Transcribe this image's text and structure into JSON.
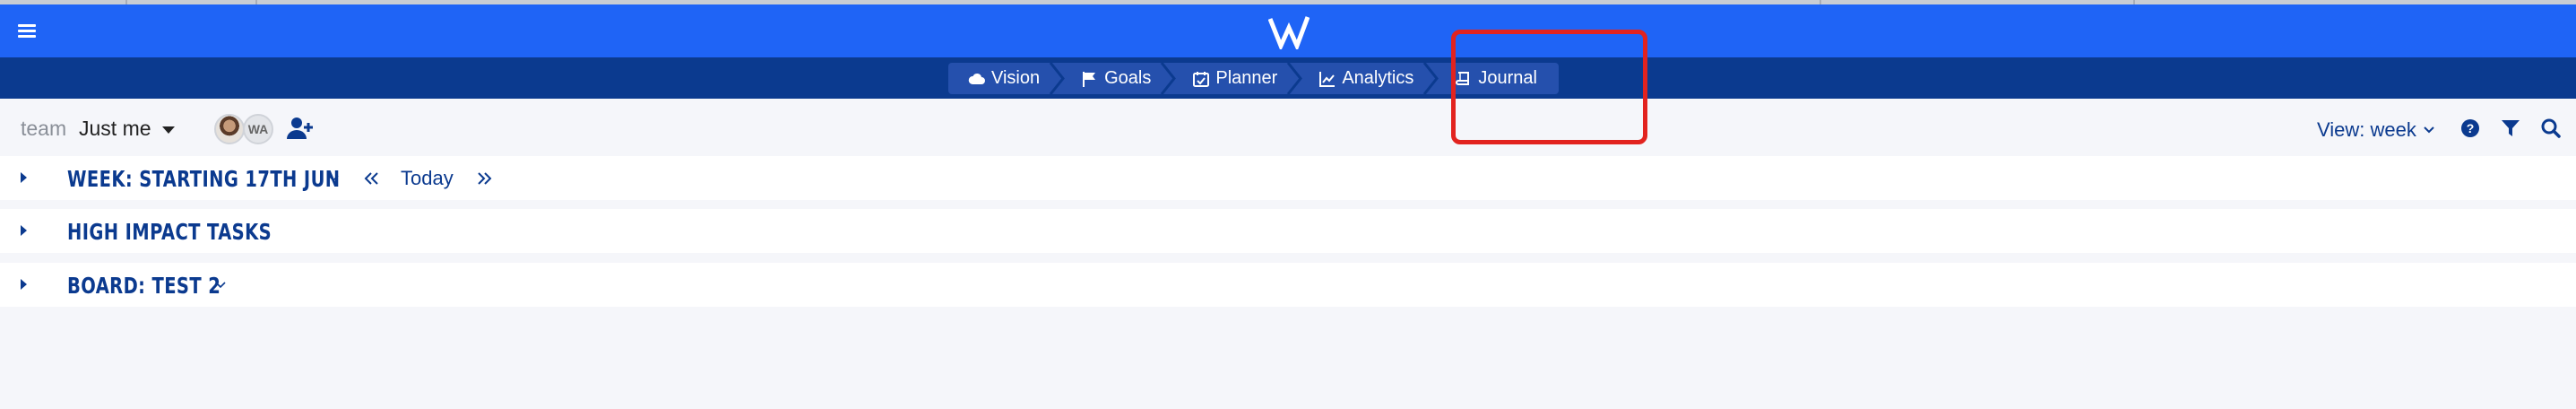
{
  "header": {
    "menu_icon": "hamburger-icon",
    "logo_icon": "w-logo-icon",
    "brand_color": "#1f64f6",
    "nav_color": "#0b3a8f"
  },
  "nav": {
    "items": [
      {
        "label": "Vision",
        "icon": "cloud-icon"
      },
      {
        "label": "Goals",
        "icon": "flag-icon"
      },
      {
        "label": "Planner",
        "icon": "calendar-check-icon"
      },
      {
        "label": "Analytics",
        "icon": "line-chart-icon"
      },
      {
        "label": "Journal",
        "icon": "book-icon"
      }
    ]
  },
  "toolbar": {
    "team_label": "team",
    "team_value": "Just me",
    "avatar_initials": "WA",
    "view_label": "View: week"
  },
  "sections": {
    "week": {
      "title": "Week: Starting 17th Jun",
      "today_label": "Today"
    },
    "tasks": {
      "title": "High Impact Tasks"
    },
    "board": {
      "title": "Board: Test 2"
    }
  },
  "annotation": {
    "color": "#e2231f"
  }
}
